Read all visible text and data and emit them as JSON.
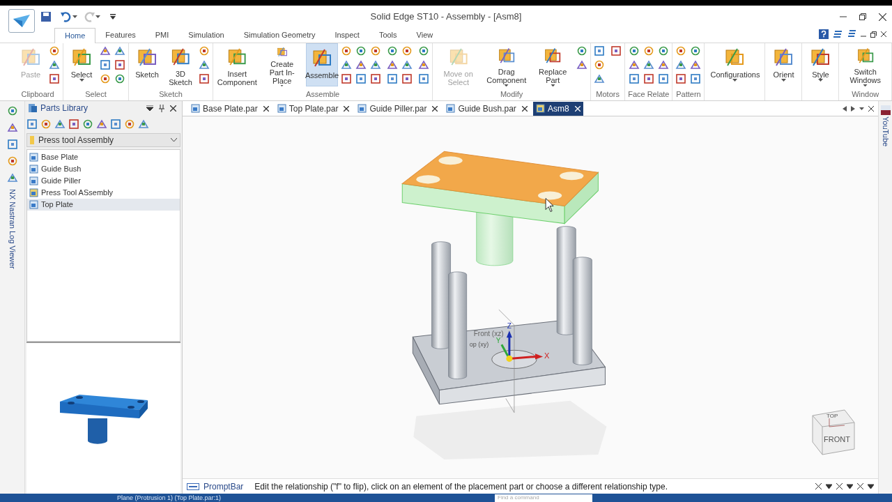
{
  "window": {
    "title": "Solid Edge ST10 - Assembly - [Asm8]"
  },
  "ribbon_tabs": [
    {
      "label": "Home",
      "selected": true
    },
    {
      "label": "Features",
      "selected": false
    },
    {
      "label": "PMI",
      "selected": false
    },
    {
      "label": "Simulation",
      "selected": false
    },
    {
      "label": "Simulation Geometry",
      "selected": false
    },
    {
      "label": "Inspect",
      "selected": false
    },
    {
      "label": "Tools",
      "selected": false
    },
    {
      "label": "View",
      "selected": false
    }
  ],
  "ribbon_groups": [
    {
      "label": "Clipboard",
      "items": [
        {
          "kind": "button",
          "label": "Paste",
          "disabled": true,
          "selected": false,
          "dropdown": false
        },
        {
          "kind": "icons"
        }
      ]
    },
    {
      "label": "Select",
      "items": [
        {
          "kind": "button",
          "label": "Select",
          "disabled": false,
          "selected": false,
          "dropdown": true
        },
        {
          "kind": "icons"
        }
      ]
    },
    {
      "label": "Sketch",
      "items": [
        {
          "kind": "button",
          "label": "Sketch",
          "disabled": false,
          "selected": false,
          "dropdown": false
        },
        {
          "kind": "button",
          "label": "3D Sketch",
          "disabled": false,
          "selected": false,
          "dropdown": false
        },
        {
          "kind": "icons"
        }
      ]
    },
    {
      "label": "Assemble",
      "items": [
        {
          "kind": "button",
          "label": "Insert Component",
          "disabled": false,
          "selected": false,
          "dropdown": false
        },
        {
          "kind": "button",
          "label": "Create Part In-Place",
          "disabled": false,
          "selected": false,
          "dropdown": true
        },
        {
          "kind": "button",
          "label": "Assemble",
          "disabled": false,
          "selected": true,
          "dropdown": false
        },
        {
          "kind": "icons"
        }
      ]
    },
    {
      "label": "Modify",
      "items": [
        {
          "kind": "button",
          "label": "Move on Select",
          "disabled": true,
          "selected": false,
          "dropdown": false
        },
        {
          "kind": "button",
          "label": "Drag Component",
          "disabled": false,
          "selected": false,
          "dropdown": true
        },
        {
          "kind": "button",
          "label": "Replace Part",
          "disabled": false,
          "selected": false,
          "dropdown": true
        },
        {
          "kind": "icons"
        }
      ]
    },
    {
      "label": "Motors",
      "items": [
        {
          "kind": "icons"
        }
      ]
    },
    {
      "label": "Face Relate",
      "items": [
        {
          "kind": "icons"
        }
      ]
    },
    {
      "label": "Pattern",
      "items": [
        {
          "kind": "icons"
        }
      ]
    },
    {
      "items": [
        {
          "kind": "button",
          "label": "Configurations",
          "disabled": false,
          "selected": false,
          "dropdown": true
        }
      ]
    },
    {
      "items": [
        {
          "kind": "button",
          "label": "Orient",
          "disabled": false,
          "selected": false,
          "dropdown": true
        }
      ]
    },
    {
      "items": [
        {
          "kind": "button",
          "label": "Style",
          "disabled": false,
          "selected": false,
          "dropdown": true
        }
      ]
    },
    {
      "label": "Window",
      "items": [
        {
          "kind": "button",
          "label": "Switch Windows",
          "disabled": false,
          "selected": false,
          "dropdown": true
        }
      ]
    }
  ],
  "side_strip": {
    "label": "NX Nastran Log Viewer"
  },
  "parts_library": {
    "title": "Parts Library",
    "folder": "Press tool Assembly",
    "items": [
      {
        "label": "Base Plate",
        "kind": "part",
        "selected": false
      },
      {
        "label": "Guide Bush",
        "kind": "part",
        "selected": false
      },
      {
        "label": "Guide Piller",
        "kind": "part",
        "selected": false
      },
      {
        "label": "Press Tool ASsembly",
        "kind": "assembly",
        "selected": false
      },
      {
        "label": "Top Plate",
        "kind": "part",
        "selected": true
      }
    ]
  },
  "document_tabs": [
    {
      "label": "Base Plate.par",
      "kind": "part",
      "selected": false
    },
    {
      "label": "Top Plate.par",
      "kind": "part",
      "selected": false
    },
    {
      "label": "Guide Piller.par",
      "kind": "part",
      "selected": false
    },
    {
      "label": "Guide Bush.par",
      "kind": "part",
      "selected": false
    },
    {
      "label": "Asm8",
      "kind": "assembly",
      "selected": true
    }
  ],
  "viewport": {
    "plane_labels": [
      "Front (xz)",
      "op (xy)"
    ],
    "axes": [
      "Z",
      "Y",
      "X"
    ],
    "view_cube": {
      "top": "TOP",
      "front": "FRONT"
    }
  },
  "right_strip": {
    "label": "YouTube"
  },
  "prompt_bar": {
    "label": "PromptBar",
    "message": "Edit the relationship (\"f\" to flip), click on an element of the placement part or choose a different relationship type."
  },
  "status_bar": {
    "text": "Plane (Protrusion 1) (Top Plate.par:1)",
    "search": {
      "placeholder": "Find a command"
    }
  }
}
